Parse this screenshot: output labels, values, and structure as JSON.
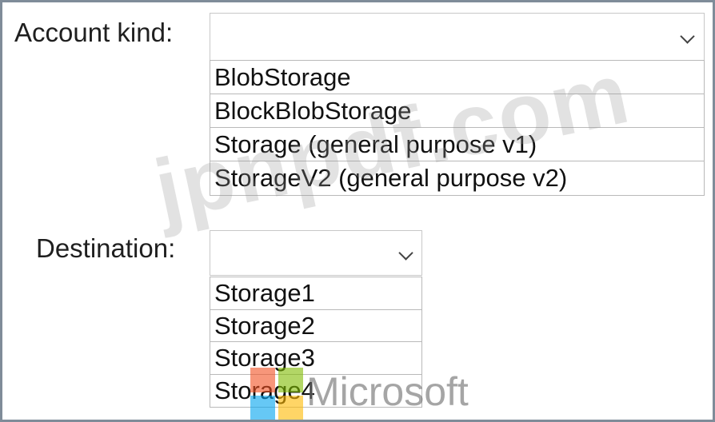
{
  "account_kind": {
    "label": "Account kind:",
    "selected": "",
    "options": [
      "BlobStorage",
      "BlockBlobStorage",
      "Storage (general purpose v1)",
      "StorageV2 (general purpose v2)"
    ]
  },
  "destination": {
    "label": "Destination:",
    "selected": "",
    "options": [
      "Storage1",
      "Storage2",
      "Storage3",
      "Storage4"
    ]
  },
  "watermark": {
    "site": "jpnpdf.com",
    "brand": "Microsoft"
  },
  "colors": {
    "logo_red": "#f25022",
    "logo_green": "#7fba00",
    "logo_blue": "#00a4ef",
    "logo_yellow": "#ffb900"
  }
}
